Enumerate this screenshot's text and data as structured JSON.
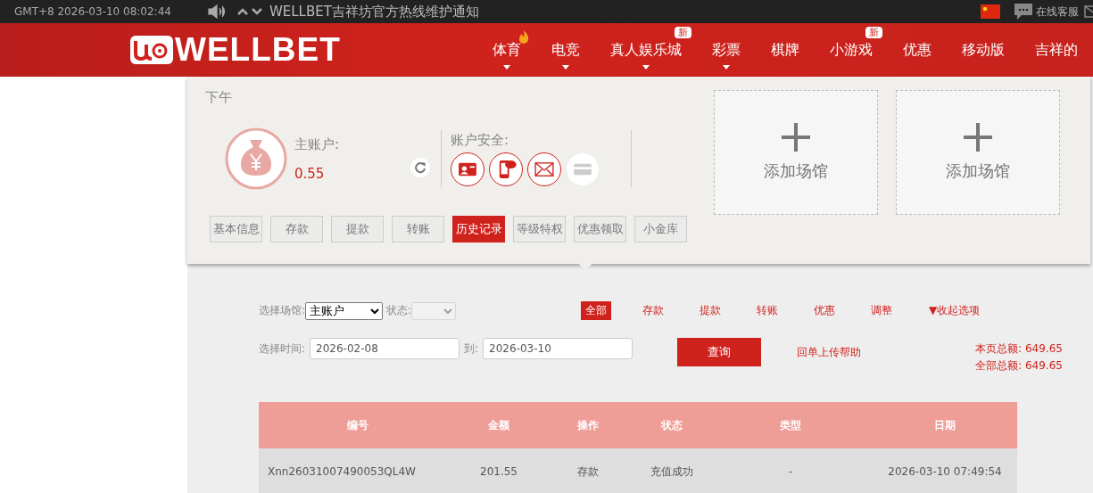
{
  "top_bar": {
    "clock": "GMT+8 2026-03-10 08:02:44",
    "notice": "WELLBET吉祥坊官方热线维护通知",
    "support": "在线客服"
  },
  "header": {
    "logo": "WELLBET",
    "nav": [
      {
        "label": "体育",
        "dropdown": true,
        "hot": true
      },
      {
        "label": "电竞",
        "dropdown": true,
        "hot": false
      },
      {
        "label": "真人娱乐城",
        "dropdown": true,
        "hot": false,
        "badge": "新"
      },
      {
        "label": "彩票",
        "dropdown": true,
        "hot": false
      },
      {
        "label": "棋牌",
        "dropdown": false,
        "hot": false
      },
      {
        "label": "小游戏",
        "dropdown": false,
        "hot": false,
        "badge": "新"
      },
      {
        "label": "优惠",
        "dropdown": false,
        "hot": false
      },
      {
        "label": "移动版",
        "dropdown": false,
        "hot": false
      },
      {
        "label": "吉祥的",
        "dropdown": false,
        "hot": false
      }
    ]
  },
  "profile": {
    "greeting": "下午",
    "main_account_label": "主账户:",
    "balance": "0.55",
    "security_label": "账户安全:",
    "security": [
      {
        "kind": "id",
        "verified": true
      },
      {
        "kind": "sms",
        "verified": true
      },
      {
        "kind": "email",
        "verified": true
      },
      {
        "kind": "card",
        "verified": false
      }
    ],
    "add_venues": [
      "添加场馆",
      "添加场馆"
    ],
    "tabs": [
      {
        "label": "基本信息",
        "selected": false
      },
      {
        "label": "存款",
        "selected": false
      },
      {
        "label": "提款",
        "selected": false
      },
      {
        "label": "转账",
        "selected": false
      },
      {
        "label": "历史记录",
        "selected": true
      },
      {
        "label": "等级特权",
        "selected": false
      },
      {
        "label": "优惠领取",
        "selected": false
      },
      {
        "label": "小金库",
        "selected": false
      }
    ]
  },
  "filters": {
    "venue_label": "选择场馆:",
    "venue_value": "主账户",
    "status_label": "状态:",
    "types": [
      {
        "label": "全部",
        "selected": true
      },
      {
        "label": "存款",
        "selected": false
      },
      {
        "label": "提款",
        "selected": false
      },
      {
        "label": "转账",
        "selected": false
      },
      {
        "label": "优惠",
        "selected": false
      },
      {
        "label": "调整",
        "selected": false
      }
    ],
    "collapse": "▼收起选项",
    "time_label": "选择时间:",
    "from": "2026-02-08",
    "to_label": "到:",
    "to": "2026-03-10",
    "query": "查询",
    "help": "回单上传帮助",
    "totals": [
      "本页总额: 649.65",
      "全部总额: 649.65"
    ]
  },
  "table": {
    "columns": [
      "编号",
      "金额",
      "操作",
      "状态",
      "类型",
      "日期"
    ],
    "rows": [
      [
        "Xnn26031007490053QL4W",
        "201.55",
        "存款",
        "充值成功",
        "-",
        "2026-03-10 07:49:54"
      ]
    ]
  }
}
